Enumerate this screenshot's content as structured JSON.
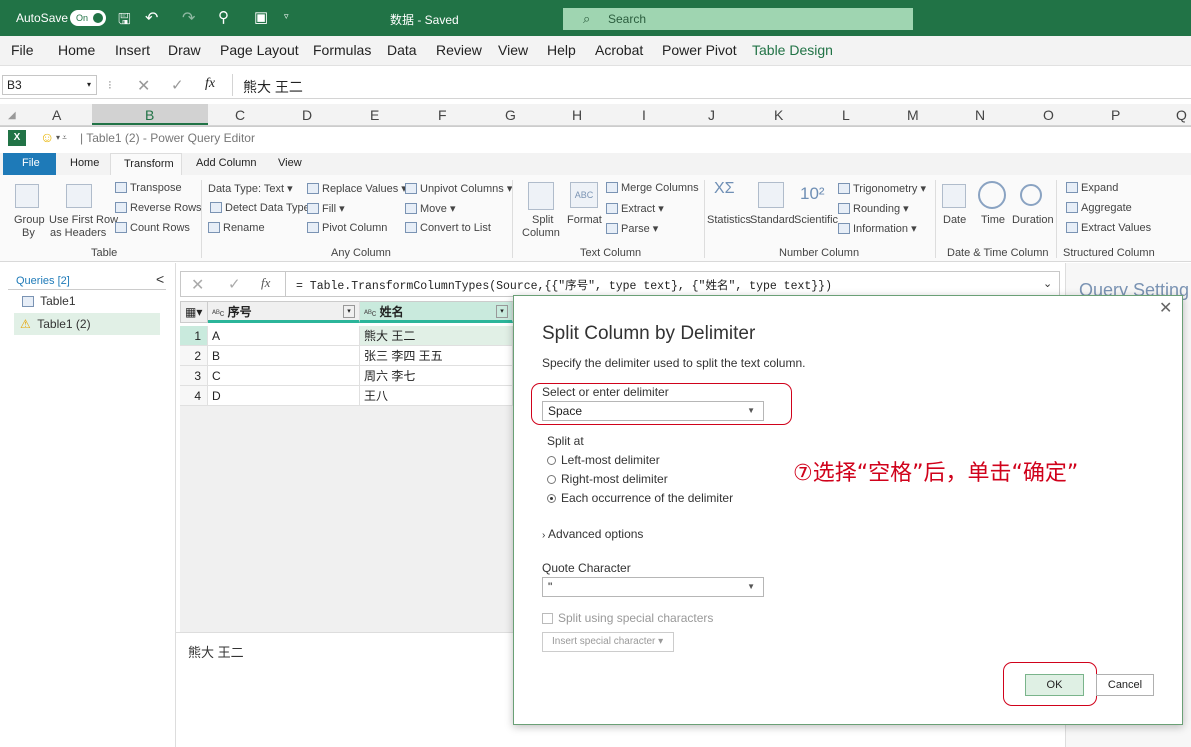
{
  "titlebar": {
    "autosave_label": "AutoSave",
    "autosave_state": "On",
    "doc_title": "数据 - Saved",
    "search_placeholder": "Search"
  },
  "menu": [
    "File",
    "Home",
    "Insert",
    "Draw",
    "Page Layout",
    "Formulas",
    "Data",
    "Review",
    "View",
    "Help",
    "Acrobat",
    "Power Pivot",
    "Table Design"
  ],
  "formula_bar": {
    "name_box": "B3",
    "fx": "fx",
    "value": "熊大 王二"
  },
  "columns": [
    "A",
    "B",
    "C",
    "D",
    "E",
    "F",
    "G",
    "H",
    "I",
    "J",
    "K",
    "L",
    "M",
    "N",
    "O",
    "P",
    "Q"
  ],
  "pq": {
    "window_title": "| Table1 (2) - Power Query Editor",
    "tabs": [
      "File",
      "Home",
      "Transform",
      "Add Column",
      "View"
    ],
    "ribbon": {
      "table": {
        "group_by": [
          "Group",
          "By"
        ],
        "first_row": [
          "Use First Row",
          "as Headers"
        ],
        "transpose": "Transpose",
        "reverse_rows": "Reverse Rows",
        "count_rows": "Count Rows",
        "label": "Table"
      },
      "any_column": {
        "data_type": "Data Type: Text",
        "detect": "Detect Data Type",
        "rename": "Rename",
        "replace": "Replace Values",
        "fill": "Fill",
        "pivot": "Pivot Column",
        "unpivot": "Unpivot Columns",
        "move": "Move",
        "convert": "Convert to List",
        "label": "Any Column"
      },
      "text_column": {
        "split": [
          "Split",
          "Column"
        ],
        "format": "Format",
        "merge": "Merge Columns",
        "extract": "Extract",
        "parse": "Parse",
        "label": "Text Column"
      },
      "number_column": {
        "statistics": "Statistics",
        "standard": "Standard",
        "scientific": "Scientific",
        "trig": "Trigonometry",
        "rounding": "Rounding",
        "information": "Information",
        "label": "Number Column"
      },
      "date_column": {
        "date": "Date",
        "time": "Time",
        "duration": "Duration",
        "label": "Date & Time Column"
      },
      "structured": {
        "expand": "Expand",
        "aggregate": "Aggregate",
        "extract_values": "Extract Values",
        "label": "Structured Column"
      }
    },
    "queries": {
      "header": "Queries [2]",
      "items": [
        "Table1",
        "Table1 (2)"
      ]
    },
    "formula": "= Table.TransformColumnTypes(Source,{{\"序号\", type text}, {\"姓名\", type text}})",
    "grid": {
      "headers": [
        "序号",
        "姓名"
      ],
      "rows": [
        [
          "1",
          "A",
          "熊大 王二"
        ],
        [
          "2",
          "B",
          "张三 李四 王五"
        ],
        [
          "3",
          "C",
          "周六 李七"
        ],
        [
          "4",
          "D",
          "王八"
        ]
      ]
    },
    "preview": "熊大 王二",
    "query_settings": "Query Setting"
  },
  "dialog": {
    "title": "Split Column by Delimiter",
    "subtitle": "Specify the delimiter used to split the text column.",
    "delimiter_label": "Select or enter delimiter",
    "delimiter_value": "Space",
    "split_at_label": "Split at",
    "options": [
      "Left-most delimiter",
      "Right-most delimiter",
      "Each occurrence of the delimiter"
    ],
    "selected_option": 2,
    "advanced": "Advanced options",
    "quote_label": "Quote Character",
    "quote_value": "\"",
    "special_chars": "Split using special characters",
    "insert_special": "Insert special character",
    "ok": "OK",
    "cancel": "Cancel"
  },
  "annotation": "⑦选择“空格”后，单击“确定”",
  "colors": {
    "excel_green": "#217346",
    "annotation_red": "#d0021b",
    "selected_row": "#e1f0e6"
  }
}
